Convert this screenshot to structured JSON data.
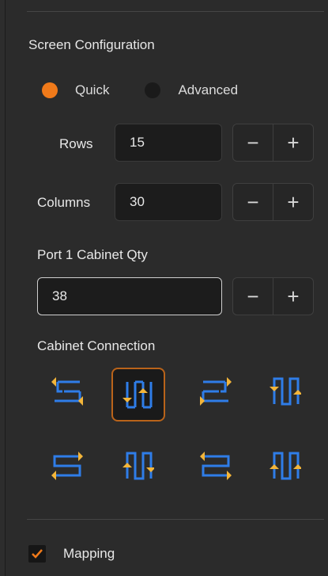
{
  "section": {
    "title": "Screen Configuration"
  },
  "mode": {
    "options": [
      {
        "label": "Quick",
        "checked": true
      },
      {
        "label": "Advanced",
        "checked": false
      }
    ]
  },
  "rows": {
    "label": "Rows",
    "value": "15"
  },
  "columns": {
    "label": "Columns",
    "value": "30"
  },
  "port": {
    "label": "Port 1 Cabinet Qty",
    "value": "38"
  },
  "stepper": {
    "minus": "−",
    "plus": "+"
  },
  "connection": {
    "label": "Cabinet Connection",
    "selected_index": 1,
    "patterns": [
      "right-start-snake-horizontal",
      "bottom-start-snake-vertical",
      "left-start-snake-horizontal",
      "top-start-snake-vertical",
      "left-start-snake-horizontal-bottom",
      "bottom-start-snake-vertical-left",
      "right-start-snake-horizontal-bottom",
      "bottom-start-snake-vertical-right"
    ]
  },
  "mapping": {
    "label": "Mapping",
    "checked": true
  },
  "colors": {
    "accent": "#f07a1a",
    "arrow_blue": "#2f7de8",
    "arrow_yellow": "#f3b53a"
  }
}
